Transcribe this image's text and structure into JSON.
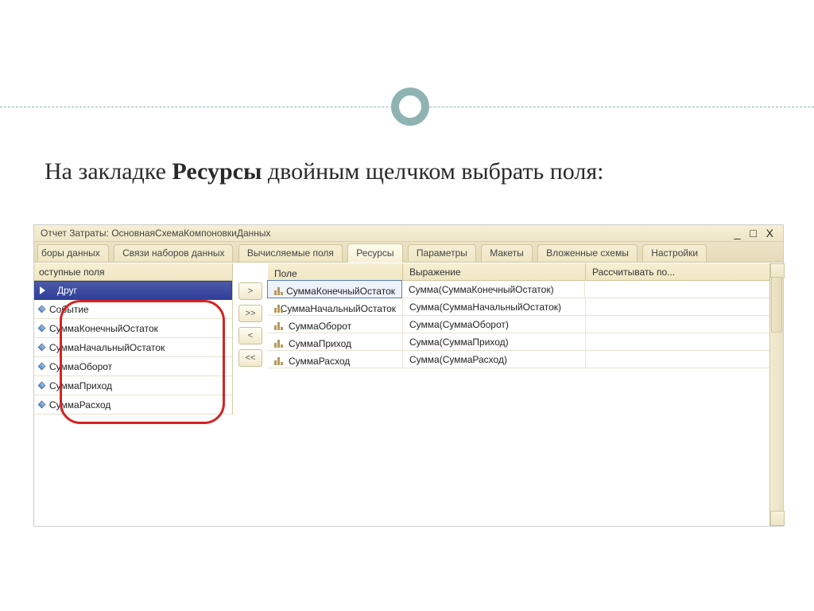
{
  "instruction": {
    "pre": "На закладке ",
    "bold": "Ресурсы",
    "post": " двойным щелчком выбрать поля:"
  },
  "window_title": "Отчет Затраты: ОсновнаяСхемаКомпоновкиДанных",
  "tabs": [
    "боры данных",
    "Связи наборов данных",
    "Вычисляемые поля",
    "Ресурсы",
    "Параметры",
    "Макеты",
    "Вложенные схемы",
    "Настройки"
  ],
  "active_tab_index": 3,
  "available_header": "оступные поля",
  "available_fields": [
    "Друг",
    "Событие",
    "СуммаКонечныйОстаток",
    "СуммаНачальныйОстаток",
    "СуммаОборот",
    "СуммаПриход",
    "СуммаРасход"
  ],
  "grid_headers": {
    "field": "Поле",
    "expr": "Выражение",
    "calc": "Рассчитывать по..."
  },
  "grid_rows": [
    {
      "field": "СуммаКонечныйОстаток",
      "expr": "Сумма(СуммаКонечныйОстаток)"
    },
    {
      "field": "СуммаНачальныйОстаток",
      "expr": "Сумма(СуммаНачальныйОстаток)"
    },
    {
      "field": "СуммаОборот",
      "expr": "Сумма(СуммаОборот)"
    },
    {
      "field": "СуммаПриход",
      "expr": "Сумма(СуммаПриход)"
    },
    {
      "field": "СуммаРасход",
      "expr": "Сумма(СуммаРасход)"
    }
  ],
  "mover": {
    "right": ">",
    "all_right": ">>",
    "left": "<",
    "all_left": "<<"
  },
  "win_ctrl": {
    "min": "_",
    "max": "□",
    "close": "X"
  }
}
